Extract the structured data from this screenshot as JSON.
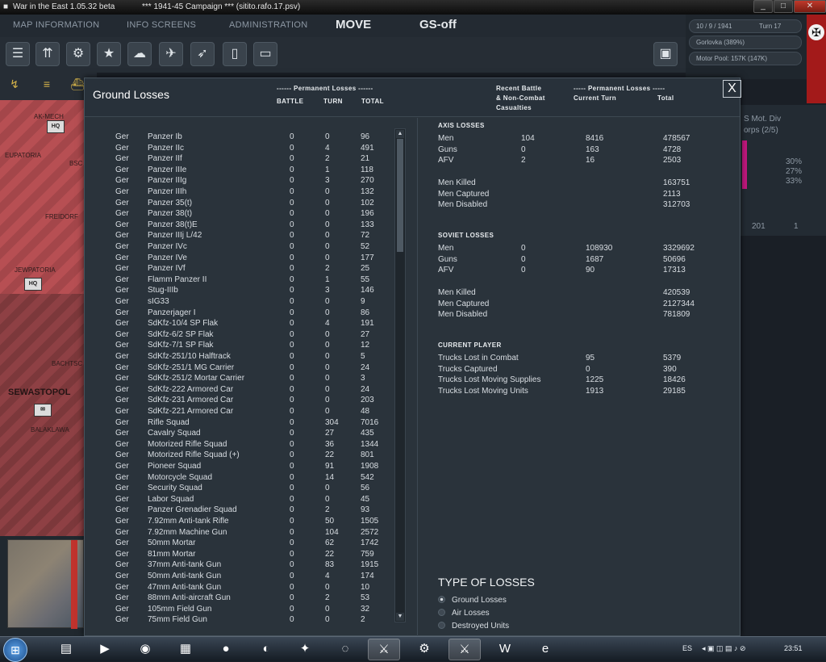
{
  "window": {
    "app_title": "War in the East 1.05.32 beta",
    "campaign": "***   1941-45 Campaign   ***   (sitito.rafo.17.psv)"
  },
  "menu": {
    "map_information": "MAP INFORMATION",
    "info_screens": "INFO SCREENS",
    "administration": "ADMINISTRATION",
    "move": "MOVE",
    "gs_off": "GS-off"
  },
  "info": {
    "date": "10 / 9 / 1941",
    "turn": "Turn 17",
    "city": "Gorlovka  (389%)",
    "motor_pool": "Motor Pool:  157K (147K)"
  },
  "map": {
    "labels": [
      "AK-MECH",
      "EUPATORIA",
      "FREIDORF",
      "JEWPATORIA",
      "BACHTSC",
      "SEWASTOPOL",
      "BALAKLAWA",
      "BSC"
    ],
    "unit_hq": "HQ"
  },
  "right_panel": {
    "unit_name": "S Mot. Div",
    "unit_sub": "orps (2/5)",
    "pct": [
      "30%",
      "27%",
      "33%"
    ],
    "counts": [
      "201",
      "1"
    ]
  },
  "dialog": {
    "title": "Ground Losses",
    "left_header": {
      "group": "------ Permanent Losses ------",
      "battle": "BATTLE",
      "turn": "TURN",
      "total": "TOTAL"
    },
    "right_header": {
      "recent_1": "Recent Battle",
      "recent_2": "& Non-Combat",
      "recent_3": "Casualties",
      "group": "----- Permanent Losses -----",
      "current_turn": "Current Turn",
      "total": "Total"
    },
    "close": "X"
  },
  "losses": [
    {
      "nat": "Ger",
      "name": "Panzer Ib",
      "battle": "0",
      "turn": "0",
      "total": "96"
    },
    {
      "nat": "Ger",
      "name": "Panzer IIc",
      "battle": "0",
      "turn": "4",
      "total": "491"
    },
    {
      "nat": "Ger",
      "name": "Panzer IIf",
      "battle": "0",
      "turn": "2",
      "total": "21"
    },
    {
      "nat": "Ger",
      "name": "Panzer IIIe",
      "battle": "0",
      "turn": "1",
      "total": "118"
    },
    {
      "nat": "Ger",
      "name": "Panzer IIIg",
      "battle": "0",
      "turn": "3",
      "total": "270"
    },
    {
      "nat": "Ger",
      "name": "Panzer IIIh",
      "battle": "0",
      "turn": "0",
      "total": "132"
    },
    {
      "nat": "Ger",
      "name": "Panzer 35(t)",
      "battle": "0",
      "turn": "0",
      "total": "102"
    },
    {
      "nat": "Ger",
      "name": "Panzer 38(t)",
      "battle": "0",
      "turn": "0",
      "total": "196"
    },
    {
      "nat": "Ger",
      "name": "Panzer 38(t)E",
      "battle": "0",
      "turn": "0",
      "total": "133"
    },
    {
      "nat": "Ger",
      "name": "Panzer IIIj L/42",
      "battle": "0",
      "turn": "0",
      "total": "72"
    },
    {
      "nat": "Ger",
      "name": "Panzer IVc",
      "battle": "0",
      "turn": "0",
      "total": "52"
    },
    {
      "nat": "Ger",
      "name": "Panzer IVe",
      "battle": "0",
      "turn": "0",
      "total": "177"
    },
    {
      "nat": "Ger",
      "name": "Panzer IVf",
      "battle": "0",
      "turn": "2",
      "total": "25"
    },
    {
      "nat": "Ger",
      "name": "Flamm Panzer II",
      "battle": "0",
      "turn": "1",
      "total": "55"
    },
    {
      "nat": "Ger",
      "name": "Stug-IIIb",
      "battle": "0",
      "turn": "3",
      "total": "146"
    },
    {
      "nat": "Ger",
      "name": "sIG33",
      "battle": "0",
      "turn": "0",
      "total": "9"
    },
    {
      "nat": "Ger",
      "name": "Panzerjager I",
      "battle": "0",
      "turn": "0",
      "total": "86"
    },
    {
      "nat": "Ger",
      "name": "SdKfz-10/4 SP Flak",
      "battle": "0",
      "turn": "4",
      "total": "191"
    },
    {
      "nat": "Ger",
      "name": "SdKfz-6/2 SP Flak",
      "battle": "0",
      "turn": "0",
      "total": "27"
    },
    {
      "nat": "Ger",
      "name": "SdKfz-7/1 SP Flak",
      "battle": "0",
      "turn": "0",
      "total": "12"
    },
    {
      "nat": "Ger",
      "name": "SdKfz-251/10 Halftrack",
      "battle": "0",
      "turn": "0",
      "total": "5"
    },
    {
      "nat": "Ger",
      "name": "SdKfz-251/1 MG Carrier",
      "battle": "0",
      "turn": "0",
      "total": "24"
    },
    {
      "nat": "Ger",
      "name": "SdKfz-251/2 Mortar Carrier",
      "battle": "0",
      "turn": "0",
      "total": "3"
    },
    {
      "nat": "Ger",
      "name": "SdKfz-222 Armored Car",
      "battle": "0",
      "turn": "0",
      "total": "24"
    },
    {
      "nat": "Ger",
      "name": "SdKfz-231 Armored Car",
      "battle": "0",
      "turn": "0",
      "total": "203"
    },
    {
      "nat": "Ger",
      "name": "SdKfz-221 Armored Car",
      "battle": "0",
      "turn": "0",
      "total": "48"
    },
    {
      "nat": "Ger",
      "name": "Rifle Squad",
      "battle": "0",
      "turn": "304",
      "total": "7016"
    },
    {
      "nat": "Ger",
      "name": "Cavalry Squad",
      "battle": "0",
      "turn": "27",
      "total": "435"
    },
    {
      "nat": "Ger",
      "name": "Motorized Rifle Squad",
      "battle": "0",
      "turn": "36",
      "total": "1344"
    },
    {
      "nat": "Ger",
      "name": "Motorized Rifle Squad (+)",
      "battle": "0",
      "turn": "22",
      "total": "801"
    },
    {
      "nat": "Ger",
      "name": "Pioneer Squad",
      "battle": "0",
      "turn": "91",
      "total": "1908"
    },
    {
      "nat": "Ger",
      "name": "Motorcycle Squad",
      "battle": "0",
      "turn": "14",
      "total": "542"
    },
    {
      "nat": "Ger",
      "name": "Security Squad",
      "battle": "0",
      "turn": "0",
      "total": "56"
    },
    {
      "nat": "Ger",
      "name": "Labor Squad",
      "battle": "0",
      "turn": "0",
      "total": "45"
    },
    {
      "nat": "Ger",
      "name": "Panzer Grenadier Squad",
      "battle": "0",
      "turn": "2",
      "total": "93"
    },
    {
      "nat": "Ger",
      "name": "7.92mm Anti-tank Rifle",
      "battle": "0",
      "turn": "50",
      "total": "1505"
    },
    {
      "nat": "Ger",
      "name": "7.92mm Machine Gun",
      "battle": "0",
      "turn": "104",
      "total": "2572"
    },
    {
      "nat": "Ger",
      "name": "50mm Mortar",
      "battle": "0",
      "turn": "62",
      "total": "1742"
    },
    {
      "nat": "Ger",
      "name": "81mm Mortar",
      "battle": "0",
      "turn": "22",
      "total": "759"
    },
    {
      "nat": "Ger",
      "name": "37mm Anti-tank Gun",
      "battle": "0",
      "turn": "83",
      "total": "1915"
    },
    {
      "nat": "Ger",
      "name": "50mm Anti-tank Gun",
      "battle": "0",
      "turn": "4",
      "total": "174"
    },
    {
      "nat": "Ger",
      "name": "47mm Anti-tank Gun",
      "battle": "0",
      "turn": "0",
      "total": "10"
    },
    {
      "nat": "Ger",
      "name": "88mm Anti-aircraft Gun",
      "battle": "0",
      "turn": "2",
      "total": "53"
    },
    {
      "nat": "Ger",
      "name": "105mm Field Gun",
      "battle": "0",
      "turn": "0",
      "total": "32"
    },
    {
      "nat": "Ger",
      "name": "75mm Field Gun",
      "battle": "0",
      "turn": "0",
      "total": "2"
    }
  ],
  "axis": {
    "title": "AXIS LOSSES",
    "rows": [
      {
        "label": "Men",
        "recent": "104",
        "turn": "8416",
        "total": "478567"
      },
      {
        "label": "Guns",
        "recent": "0",
        "turn": "163",
        "total": "4728"
      },
      {
        "label": "AFV",
        "recent": "2",
        "turn": "16",
        "total": "2503"
      }
    ],
    "killed": {
      "label": "Men Killed",
      "total": "163751"
    },
    "captured": {
      "label": "Men Captured",
      "total": "2113"
    },
    "disabled": {
      "label": "Men Disabled",
      "total": "312703"
    }
  },
  "soviet": {
    "title": "SOVIET LOSSES",
    "rows": [
      {
        "label": "Men",
        "recent": "0",
        "turn": "108930",
        "total": "3329692"
      },
      {
        "label": "Guns",
        "recent": "0",
        "turn": "1687",
        "total": "50696"
      },
      {
        "label": "AFV",
        "recent": "0",
        "turn": "90",
        "total": "17313"
      }
    ],
    "killed": {
      "label": "Men Killed",
      "total": "420539"
    },
    "captured": {
      "label": "Men Captured",
      "total": "2127344"
    },
    "disabled": {
      "label": "Men Disabled",
      "total": "781809"
    }
  },
  "current_player": {
    "title": "CURRENT PLAYER",
    "rows": [
      {
        "label": "Trucks Lost in Combat",
        "turn": "95",
        "total": "5379"
      },
      {
        "label": "Trucks Captured",
        "turn": "0",
        "total": "390"
      },
      {
        "label": "Trucks Lost Moving Supplies",
        "turn": "1225",
        "total": "18426"
      },
      {
        "label": "Trucks Lost Moving Units",
        "turn": "1913",
        "total": "29185"
      }
    ]
  },
  "type_of_losses": {
    "title": "TYPE OF LOSSES",
    "options": [
      "Ground Losses",
      "Air Losses",
      "Destroyed Units"
    ],
    "selected": "Ground Losses"
  },
  "taskbar": {
    "lang": "ES",
    "clock": "23:51"
  }
}
